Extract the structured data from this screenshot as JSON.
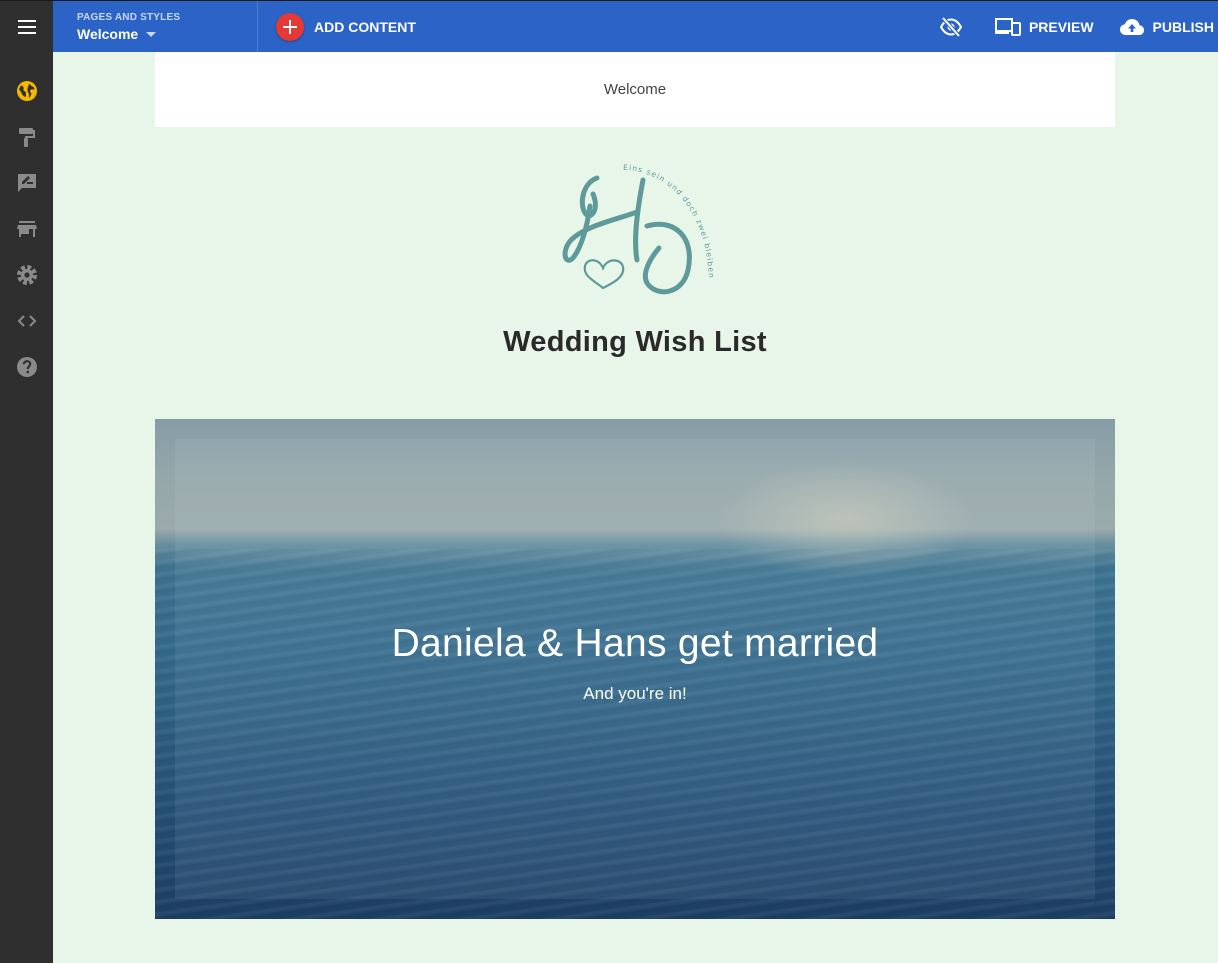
{
  "topbar": {
    "pages_label": "PAGES AND STYLES",
    "current_page": "Welcome",
    "add_content_label": "ADD CONTENT",
    "preview_label": "PREVIEW",
    "publish_label": "PUBLISH"
  },
  "sidebar": {
    "icons": [
      "globe-icon",
      "paint-roller-icon",
      "feedback-icon",
      "store-icon",
      "gear-icon",
      "code-icon",
      "help-icon"
    ],
    "accent_color": "#f5b800"
  },
  "site": {
    "nav": [
      "Welcome"
    ],
    "logo_arc_text": "Eins sein und doch zwei bleiben",
    "title": "Wedding Wish List"
  },
  "hero": {
    "title": "Daniela & Hans get married",
    "subtitle": "And you're in!"
  },
  "colors": {
    "topbar": "#2b63c6",
    "sidebar": "#2f2f2f",
    "page_bg": "#e8f6ea",
    "add_button": "#e53935",
    "logo": "#5f9a9a"
  }
}
